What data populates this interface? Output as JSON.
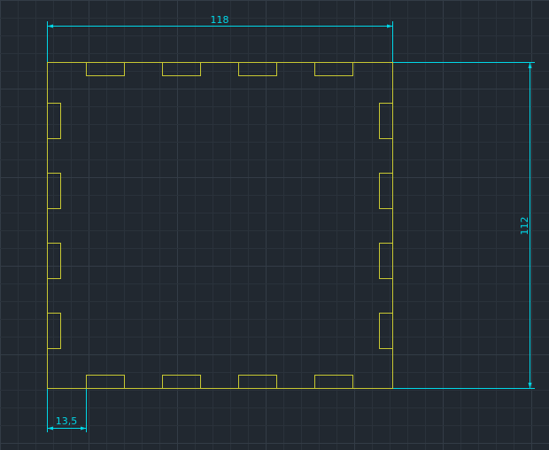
{
  "colors": {
    "background": "#212830",
    "grid_minor": "#2a323b",
    "grid_major": "#333c46",
    "outline": "#c8c832",
    "dimension": "#00d8e8"
  },
  "dimensions": {
    "width": {
      "text": "118"
    },
    "height": {
      "text": "112"
    },
    "offset": {
      "text": "13,5"
    }
  }
}
